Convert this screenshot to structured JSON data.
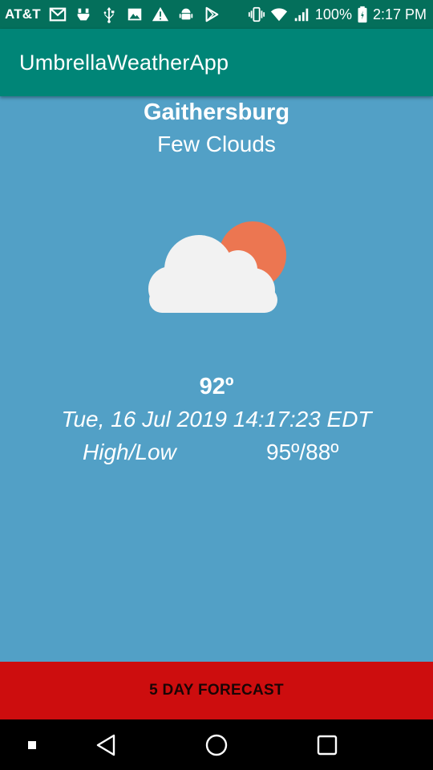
{
  "status_bar": {
    "carrier": "AT&T",
    "notification_icons": [
      "gmail-icon",
      "usb-debug-icon",
      "usb-icon",
      "image-icon",
      "warning-icon",
      "android-icon",
      "play-store-icon"
    ],
    "system_icons": [
      "vibrate-icon",
      "wifi-icon",
      "signal-icon",
      "battery-icon"
    ],
    "battery": "100%",
    "time": "2:17 PM"
  },
  "app_bar": {
    "title": "UmbrellaWeatherApp"
  },
  "weather": {
    "city": "Gaithersburg",
    "condition": "Few Clouds",
    "icon": "partly-cloudy-icon",
    "temperature": "92º",
    "datetime": "Tue, 16 Jul 2019 14:17:23 EDT",
    "high_low_label": "High/Low",
    "high_low_value": "95º/88º"
  },
  "forecast_button": {
    "label": "5 DAY FORECAST"
  },
  "nav_bar": {
    "buttons": [
      "square-small-icon",
      "back-icon",
      "home-icon",
      "recents-icon"
    ]
  },
  "colors": {
    "status_bar": "#046f5b",
    "app_bar": "#008577",
    "background": "#52a0c6",
    "sun": "#ec7651",
    "cloud": "#f2f2f2",
    "forecast_button": "#cd0d0e"
  }
}
